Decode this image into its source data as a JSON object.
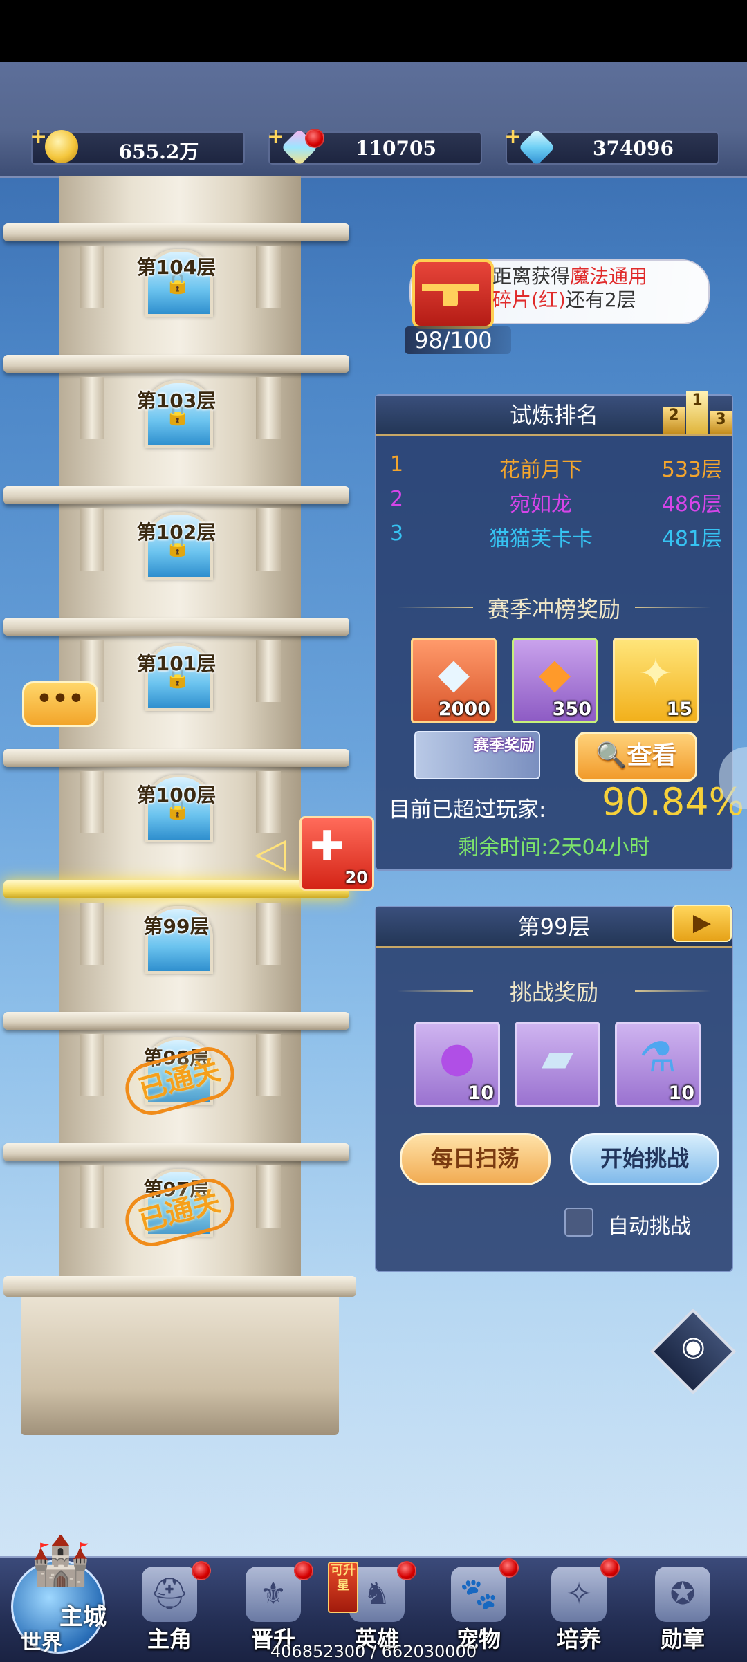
{
  "currencies": [
    {
      "value": "655.2万",
      "icon": "gold-coin-icon",
      "has_dot": false
    },
    {
      "value": "110705",
      "icon": "crystal-gem-icon",
      "has_dot": true
    },
    {
      "value": "374096",
      "icon": "blue-diamond-icon",
      "has_dot": false
    }
  ],
  "tower": {
    "floors": [
      {
        "label": "第104层",
        "state": "locked"
      },
      {
        "label": "第103层",
        "state": "locked"
      },
      {
        "label": "第102层",
        "state": "locked"
      },
      {
        "label": "第101层",
        "state": "locked"
      },
      {
        "label": "第100层",
        "state": "locked"
      },
      {
        "label": "第99层",
        "state": "current"
      },
      {
        "label": "第98层",
        "state": "cleared"
      },
      {
        "label": "第97层",
        "state": "cleared"
      }
    ],
    "cleared_stamp": "已通关",
    "puzzle_count": "20"
  },
  "chest": {
    "text_a": "距离获得",
    "text_red": "魔法通用",
    "text_red2": "碎片(红)",
    "text_b": "还有2层",
    "progress": "98/100"
  },
  "ranking": {
    "title": "试炼排名",
    "rows": [
      {
        "rank": "1",
        "name": "花前月下",
        "floor": "533层",
        "color": "#f3a52d"
      },
      {
        "rank": "2",
        "name": "宛如龙",
        "floor": "486层",
        "color": "#d545e8"
      },
      {
        "rank": "3",
        "name": "猫猫芙卡卡",
        "floor": "481层",
        "color": "#36c3f2"
      }
    ],
    "season_reward_title": "赛季冲榜奖励",
    "rewards": [
      {
        "count": "2000",
        "icon": "rainbow-diamond-icon"
      },
      {
        "count": "350",
        "icon": "orange-crystal-icon"
      },
      {
        "count": "15",
        "icon": "golden-flame-icon"
      }
    ],
    "season_badge": "赛季奖励",
    "view_button": "查看",
    "surpass_label": "目前已超过玩家:",
    "surpass_value": "90.84%",
    "remaining": "剩余时间:2天04小时"
  },
  "floor_panel": {
    "title": "第99层",
    "challenge_reward_title": "挑战奖励",
    "rewards": [
      {
        "count": "10",
        "icon": "purple-orb-icon"
      },
      {
        "count": "",
        "icon": "blue-card-icon"
      },
      {
        "count": "10",
        "icon": "potion-bottle-icon"
      }
    ],
    "sweep_button": "每日扫荡",
    "challenge_button": "开始挑战",
    "auto_label": "自动挑战"
  },
  "bottom_nav": {
    "main_city": "主城",
    "world": "世界",
    "upgrade_tag": "可升星",
    "items": [
      {
        "label": "主角",
        "icon": "hero-helmet-icon",
        "has_dot": true
      },
      {
        "label": "晋升",
        "icon": "promotion-icon",
        "has_dot": true
      },
      {
        "label": "英雄",
        "icon": "knight-icon",
        "has_dot": true
      },
      {
        "label": "宠物",
        "icon": "pet-icon",
        "has_dot": true
      },
      {
        "label": "培养",
        "icon": "cultivate-icon",
        "has_dot": true
      },
      {
        "label": "勋章",
        "icon": "medal-icon",
        "has_dot": false
      }
    ]
  },
  "footer_text": "406852300 / 662030000",
  "colors": {
    "accent_gold": "#f6d13a",
    "green_text": "#7de36b",
    "panel_bg": "#293f6e"
  }
}
